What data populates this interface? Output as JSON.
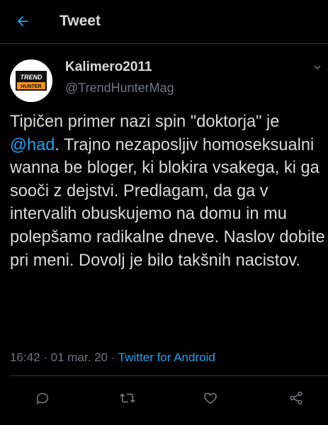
{
  "header": {
    "back_icon": "arrow-left-icon",
    "title": "Tweet"
  },
  "author": {
    "avatar_line1": "TREND",
    "avatar_line2": "HUNTER",
    "display_name": "Kalimero2011",
    "handle": "@TrendHunterMag"
  },
  "tweet": {
    "text_before_mention": "Tipičen primer nazi spin \"doktorja\" je ",
    "mention": "@had",
    "text_after_mention": ". Trajno nezaposljiv homoseksualni wanna be bloger, ki blokira vsakega, ki ga sooči z dejstvi. Predlagam, da ga v intervalih obuskujemo na domu in mu polepšamo radikalne dneve. Naslov dobite pri meni. Dovolj je bilo takšnih nacistov."
  },
  "meta": {
    "time": "16:42",
    "separator": " · ",
    "date": "01 mar. 20",
    "source": "Twitter for Android"
  },
  "actions": [
    {
      "icon": "reply-icon"
    },
    {
      "icon": "retweet-icon"
    },
    {
      "icon": "like-icon"
    },
    {
      "icon": "share-icon"
    }
  ],
  "colors": {
    "background": "#000000",
    "text": "#d9d9d9",
    "secondary": "#6e767d",
    "accent": "#1da1f2",
    "avatar_orange": "#f7941d"
  }
}
